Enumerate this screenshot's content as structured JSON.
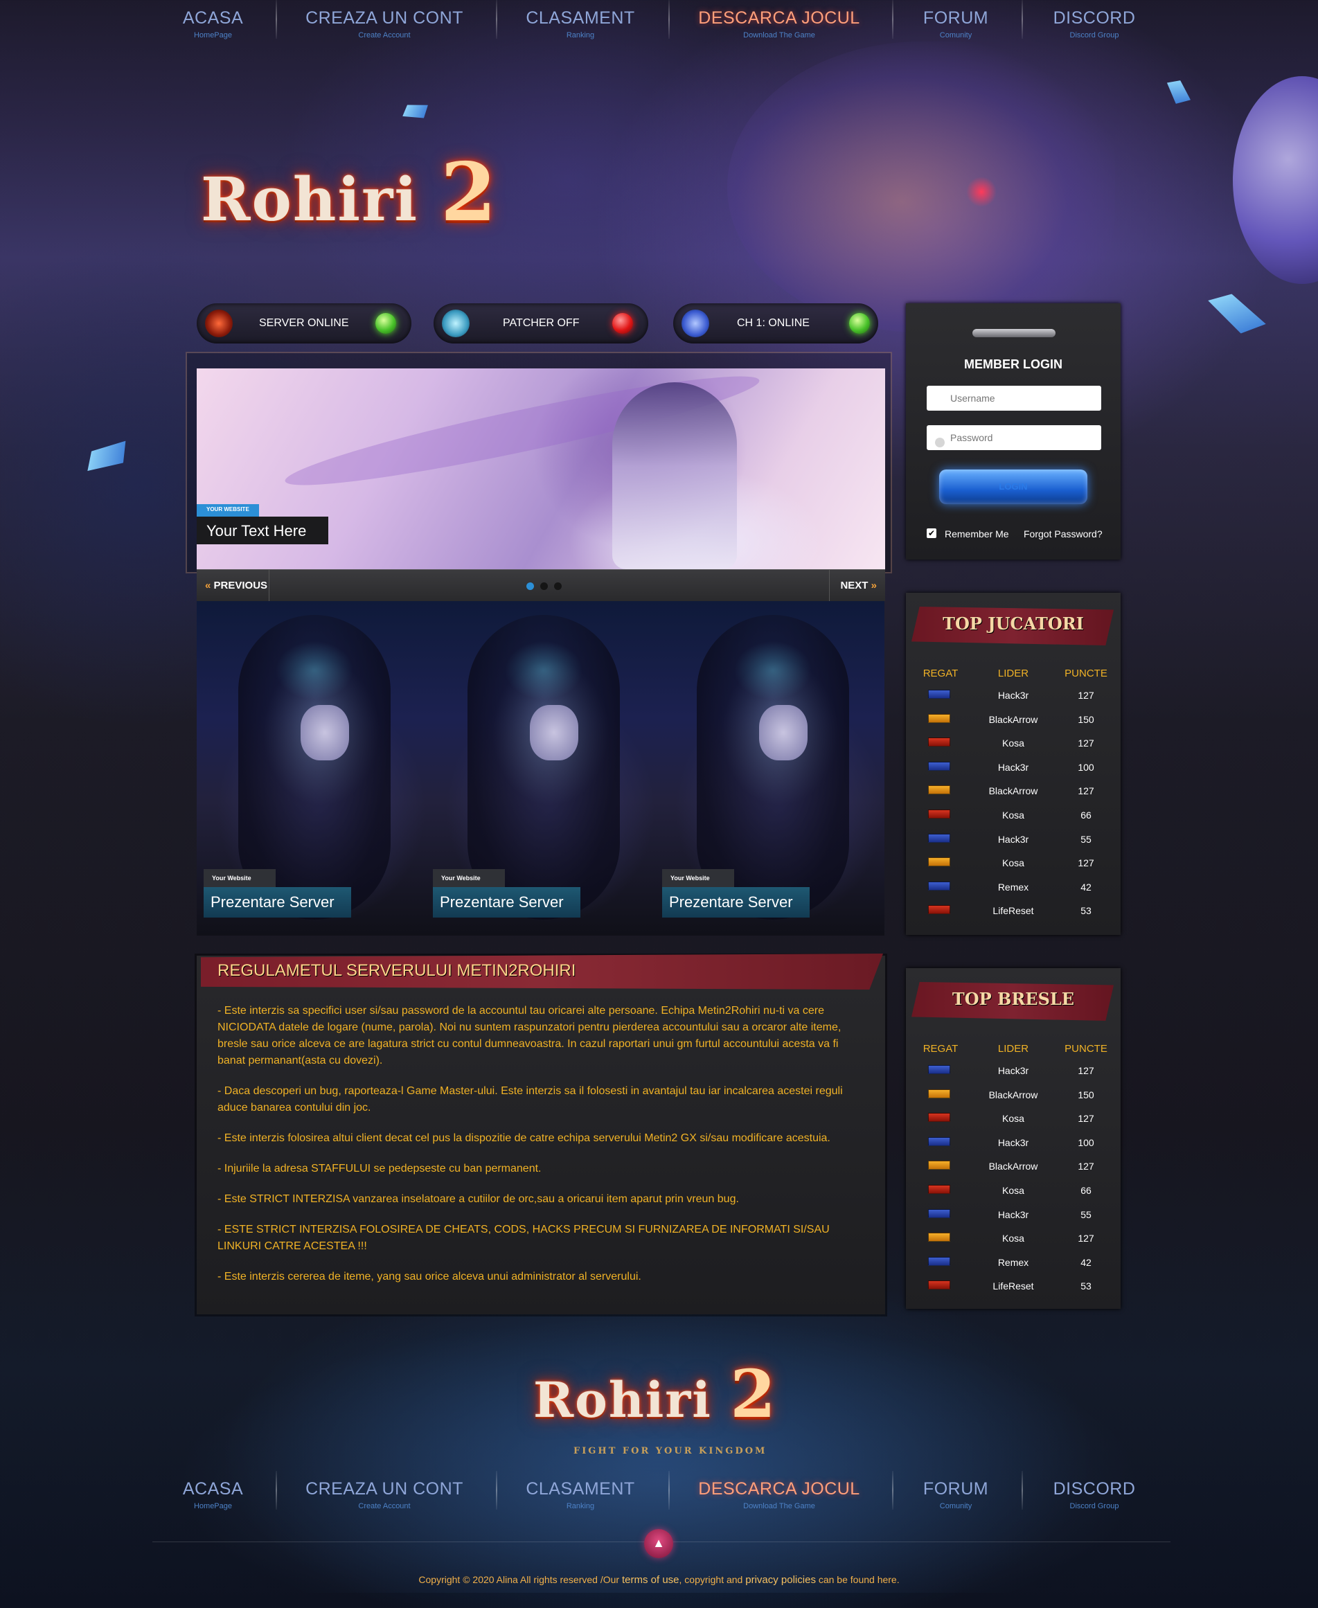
{
  "nav": [
    {
      "label": "ACASA",
      "sub": "HomePage"
    },
    {
      "label": "CREAZA UN CONT",
      "sub": "Create Account"
    },
    {
      "label": "CLASAMENT",
      "sub": "Ranking"
    },
    {
      "label": "DESCARCA JOCUL",
      "sub": "Download The Game"
    },
    {
      "label": "FORUM",
      "sub": "Comunity"
    },
    {
      "label": "DISCORD",
      "sub": "Discord Group"
    }
  ],
  "logo": {
    "name": "Rohiri",
    "number": "2",
    "tagline": "FIGHT FOR YOUR KINGDOM"
  },
  "status": [
    {
      "label": "SERVER ONLINE",
      "icon": "fire-emblem-icon",
      "state": "online"
    },
    {
      "label": "PATCHER OFF",
      "icon": "crystal-emblem-icon",
      "state": "offline"
    },
    {
      "label": "CH 1: ONLINE",
      "icon": "shield-emblem-icon",
      "state": "online"
    }
  ],
  "slider": {
    "tag": "YOUR WEBSITE",
    "title": "Your Text Here",
    "prev": "PREVIOUS",
    "next": "NEXT",
    "active_dot": 0
  },
  "cards": [
    {
      "tag": "Your Website",
      "title": "Prezentare Server"
    },
    {
      "tag": "Your Website",
      "title": "Prezentare Server"
    },
    {
      "tag": "Your Website",
      "title": "Prezentare Server"
    }
  ],
  "rules": {
    "title": "REGULAMETUL SERVERULUI METIN2ROHIRI",
    "paragraphs": [
      "- Este interzis sa specifici user si/sau password de la accountul tau oricarei alte persoane. Echipa Metin2Rohiri nu-ti va cere NICIODATA datele de logare (nume, parola). Noi nu suntem raspunzatori pentru pierderea accountului sau a orcaror alte iteme, bresle sau orice alceva ce are lagatura strict cu contul dumneavoastra. In cazul raportari unui gm furtul accountului acesta va fi banat permanant(asta cu dovezi).",
      "- Daca descoperi un bug, raporteaza-l Game Master-ului. Este interzis sa il folosesti in avantajul tau iar incalcarea acestei reguli aduce banarea contului din joc.",
      "- Este interzis folosirea altui client decat cel pus la dispozitie de catre echipa serverului Metin2 GX si/sau modificare acestuia.",
      "- Injuriile la adresa STAFFULUI se pedepseste cu ban permanent.",
      "- Este STRICT INTERZISA vanzarea inselatoare a cutiilor de orc,sau a oricarui item aparut prin vreun bug.",
      "- ESTE STRICT INTERZISA FOLOSIREA DE CHEATS, CODS, HACKS PRECUM SI FURNIZAREA DE INFORMATI SI/SAU LINKURI CATRE ACESTEA !!!",
      "- Este interzis cererea de iteme, yang sau orice alceva unui administrator al serverului."
    ]
  },
  "login": {
    "title": "MEMBER LOGIN",
    "username_placeholder": "Username",
    "password_placeholder": "Password",
    "button": "LOGIN",
    "remember": "Remember Me",
    "forgot": "Forgot Password?"
  },
  "top_players": {
    "title": "TOP JUCATORI",
    "columns": [
      "REGAT",
      "LIDER",
      "PUNCTE"
    ],
    "rows": [
      {
        "kingdom": "blue",
        "name": "Hack3r",
        "points": "127"
      },
      {
        "kingdom": "yellow",
        "name": "BlackArrow",
        "points": "150"
      },
      {
        "kingdom": "red",
        "name": "Kosa",
        "points": "127"
      },
      {
        "kingdom": "blue",
        "name": "Hack3r",
        "points": "100"
      },
      {
        "kingdom": "yellow",
        "name": "BlackArrow",
        "points": "127"
      },
      {
        "kingdom": "red",
        "name": "Kosa",
        "points": "66"
      },
      {
        "kingdom": "blue",
        "name": "Hack3r",
        "points": "55"
      },
      {
        "kingdom": "yellow",
        "name": "Kosa",
        "points": "127"
      },
      {
        "kingdom": "blue",
        "name": "Remex",
        "points": "42"
      },
      {
        "kingdom": "red",
        "name": "LifeReset",
        "points": "53"
      }
    ]
  },
  "top_guilds": {
    "title": "TOP BRESLE",
    "columns": [
      "REGAT",
      "LIDER",
      "PUNCTE"
    ],
    "rows": [
      {
        "kingdom": "blue",
        "name": "Hack3r",
        "points": "127"
      },
      {
        "kingdom": "yellow",
        "name": "BlackArrow",
        "points": "150"
      },
      {
        "kingdom": "red",
        "name": "Kosa",
        "points": "127"
      },
      {
        "kingdom": "blue",
        "name": "Hack3r",
        "points": "100"
      },
      {
        "kingdom": "yellow",
        "name": "BlackArrow",
        "points": "127"
      },
      {
        "kingdom": "red",
        "name": "Kosa",
        "points": "66"
      },
      {
        "kingdom": "blue",
        "name": "Hack3r",
        "points": "55"
      },
      {
        "kingdom": "yellow",
        "name": "Kosa",
        "points": "127"
      },
      {
        "kingdom": "blue",
        "name": "Remex",
        "points": "42"
      },
      {
        "kingdom": "red",
        "name": "LifeReset",
        "points": "53"
      }
    ]
  },
  "footer": {
    "copyright_prefix": "Copyright © 2020 Alina All rights reserved /Our ",
    "terms": "terms of use",
    "middle": ", copyright and ",
    "privacy": "privacy policies",
    "suffix": " can be found here.",
    "to_top_icon": "arrow-up-icon"
  },
  "colors": {
    "accent_orange": "#f0b226",
    "nav_blue": "#8fa6d8",
    "nav_active": "#ff9f7a",
    "header_red": "#7a1e2a",
    "link_blue": "#2c8fd6"
  }
}
